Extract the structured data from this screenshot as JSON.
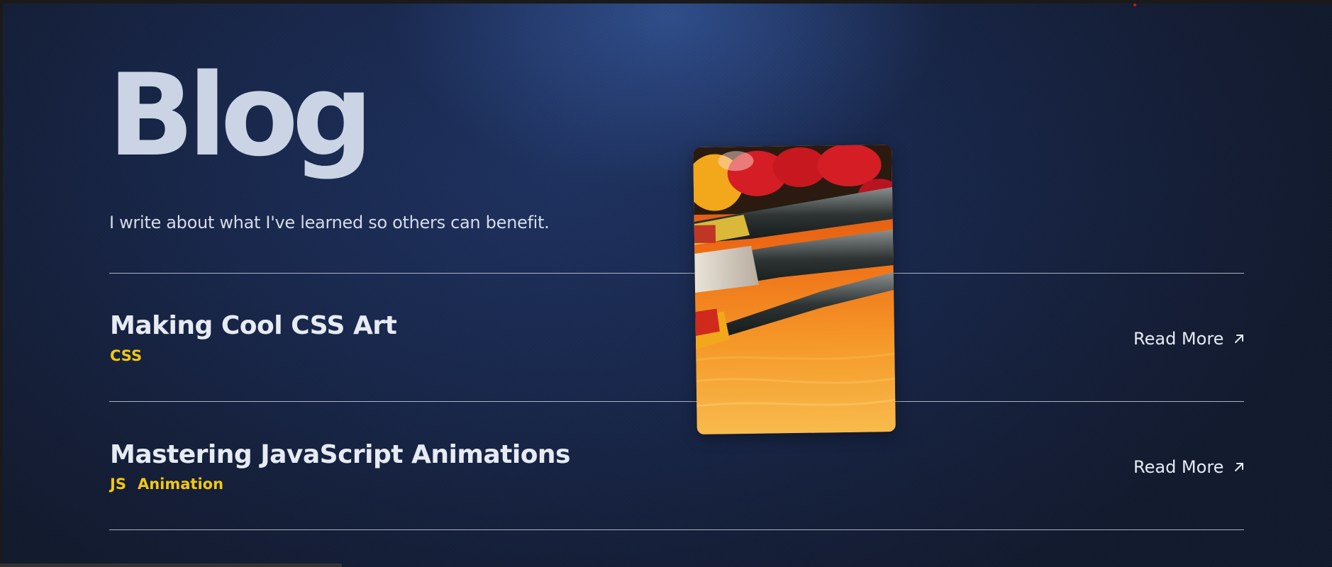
{
  "header": {
    "title": "Blog",
    "subtitle": "I write about what I've learned so others can benefit."
  },
  "posts": [
    {
      "title": "Making Cool CSS Art",
      "tags": [
        "CSS"
      ],
      "read_more": "Read More"
    },
    {
      "title": "Mastering JavaScript Animations",
      "tags": [
        "JS",
        "Animation"
      ],
      "read_more": "Read More"
    }
  ],
  "preview": {
    "icon": "paintbrush-image"
  },
  "colors": {
    "background": "#18274b",
    "text": "#e6ebf3",
    "title": "#cad4e4",
    "tag": "#f2c811",
    "divider": "#dce4f0"
  }
}
